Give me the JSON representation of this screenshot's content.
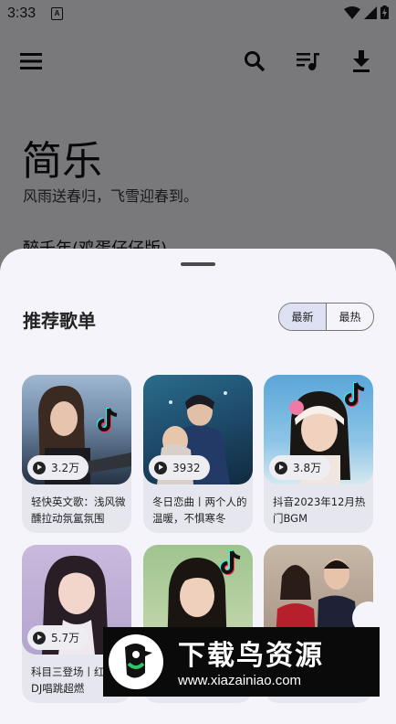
{
  "status": {
    "time": "3:33",
    "notif_letter": "A"
  },
  "toolbar": {
    "menu_icon": "menu-icon",
    "search_icon": "search-icon",
    "queue_icon": "playlist-icon",
    "download_icon": "download-icon"
  },
  "app": {
    "title": "简乐",
    "subtitle": "风雨送春归，飞雪迎春到。",
    "now_playing": "醉千年(鸡蛋仔仔版)"
  },
  "sheet": {
    "title": "推荐歌单",
    "tabs": [
      {
        "label": "最新",
        "active": true
      },
      {
        "label": "最热",
        "active": false
      }
    ],
    "playlists": [
      {
        "plays": "3.2万",
        "name": "轻快英文歌：浅风微醺拉动氛氲氛围"
      },
      {
        "plays": "3932",
        "name": "冬日恋曲丨两个人的温暖，不惧寒冬"
      },
      {
        "plays": "3.8万",
        "name": "抖音2023年12月热门BGM"
      },
      {
        "plays": "5.7万",
        "name": "科目三登场丨红毯DJ唱跳超燃"
      },
      {
        "plays": "",
        "name": ""
      },
      {
        "plays": "",
        "name": ""
      }
    ]
  },
  "watermark": {
    "text": "下载鸟资源",
    "url": "www.xiazainiao.com"
  }
}
